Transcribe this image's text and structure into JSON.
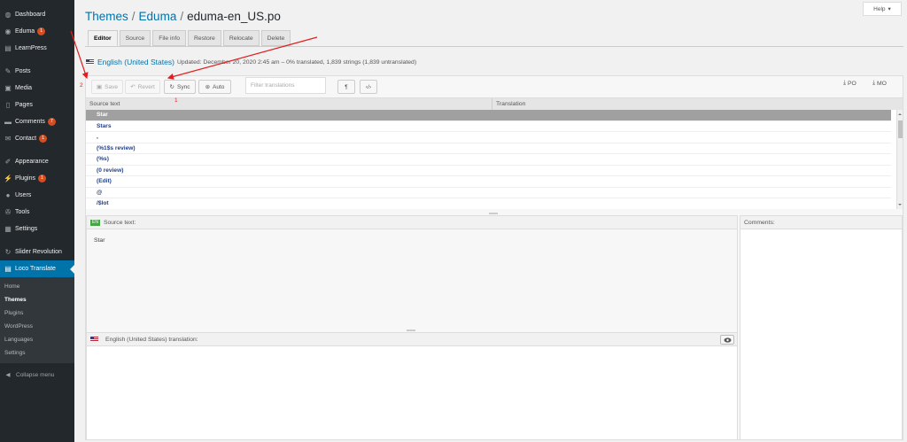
{
  "sidebar": {
    "items": [
      {
        "label": "Dashboard",
        "icon": "dashboard-icon",
        "glyph": "◍"
      },
      {
        "label": "Eduma",
        "icon": "eduma-icon",
        "glyph": "◉",
        "badge": "1"
      },
      {
        "label": "LearnPress",
        "icon": "learnpress-icon",
        "glyph": "▤"
      },
      {
        "label": "Posts",
        "icon": "pin-icon",
        "glyph": "✎",
        "gap": true
      },
      {
        "label": "Media",
        "icon": "media-icon",
        "glyph": "▣"
      },
      {
        "label": "Pages",
        "icon": "pages-icon",
        "glyph": "▯"
      },
      {
        "label": "Comments",
        "icon": "comments-icon",
        "glyph": "▬",
        "badge": "7"
      },
      {
        "label": "Contact",
        "icon": "envelope-icon",
        "glyph": "✉",
        "badge": "1"
      },
      {
        "label": "Appearance",
        "icon": "brush-icon",
        "glyph": "✐",
        "gap": true
      },
      {
        "label": "Plugins",
        "icon": "plug-icon",
        "glyph": "⚡",
        "badge": "1"
      },
      {
        "label": "Users",
        "icon": "user-icon",
        "glyph": "●"
      },
      {
        "label": "Tools",
        "icon": "wrench-icon",
        "glyph": "✇"
      },
      {
        "label": "Settings",
        "icon": "settings-icon",
        "glyph": "▦"
      },
      {
        "label": "Slider Revolution",
        "icon": "refresh-icon",
        "glyph": "↻",
        "gap": true
      },
      {
        "label": "Loco Translate",
        "icon": "translate-icon",
        "glyph": "▤",
        "active": true
      }
    ],
    "submenu": [
      "Home",
      "Themes",
      "Plugins",
      "WordPress",
      "Languages",
      "Settings"
    ],
    "submenu_current": "Themes",
    "collapse_label": "Collapse menu"
  },
  "help_label": "Help",
  "breadcrumb": {
    "item1": "Themes",
    "item2": "Eduma",
    "current": "eduma-en_US.po",
    "sep": "/"
  },
  "tabs": [
    "Editor",
    "Source",
    "File info",
    "Restore",
    "Relocate",
    "Delete"
  ],
  "locale": {
    "name": "English (United States)",
    "status": "Updated: December 20, 2020 2:45 am – 0% translated, 1,839 strings (1,839 untranslated)"
  },
  "toolbar": {
    "save": "Save",
    "revert": "Revert",
    "sync": "Sync",
    "auto": "Auto",
    "filter_placeholder": "Filter translations",
    "po": "PO",
    "mo": "MO"
  },
  "grid": {
    "headers": [
      "Source text",
      "Translation"
    ],
    "rows": [
      "Star",
      "Stars",
      ",",
      "(%1$s review)",
      "(%s)",
      "(0 review)",
      "(Edit)",
      "@",
      "/$lot"
    ]
  },
  "source_pane": {
    "lang_code": "EN",
    "title": "Source text:",
    "text": "Star"
  },
  "translation_pane": {
    "title": "English (United States) translation:"
  },
  "comments_pane": {
    "title": "Comments:"
  },
  "annotations": {
    "one": "1",
    "two": "2"
  },
  "colors": {
    "sidebar_bg": "#23282d",
    "accent": "#0073aa",
    "badge": "#d54e21",
    "annotation": "#e02020"
  }
}
